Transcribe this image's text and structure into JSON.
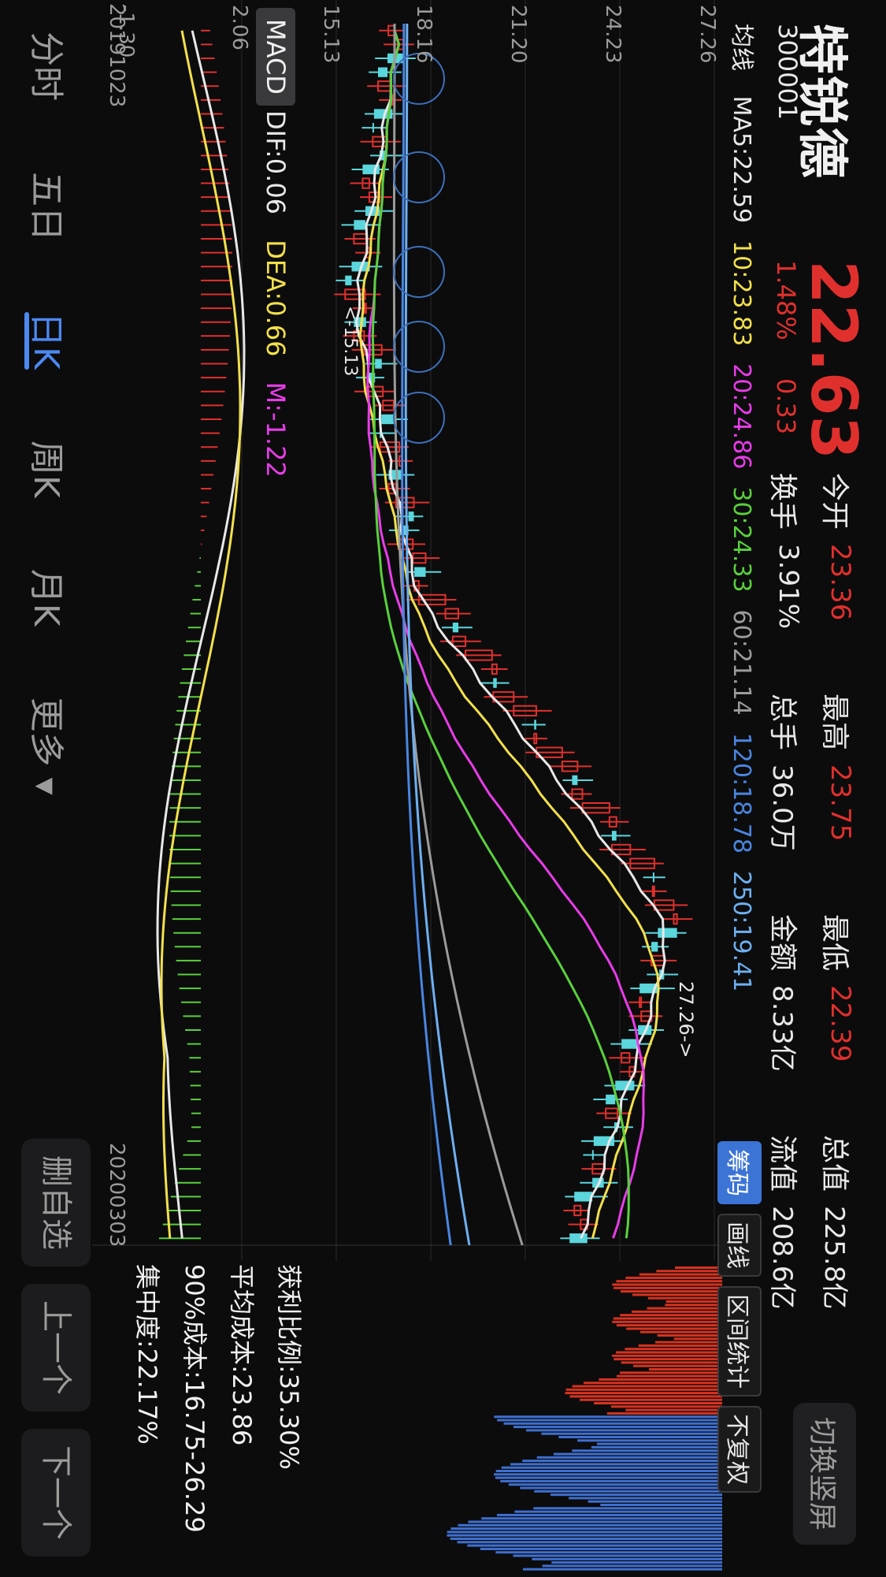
{
  "header": {
    "name": "特锐德",
    "code": "300001",
    "price": "22.63",
    "change_pct": "1.48%",
    "change_abs": "0.33",
    "stats": [
      {
        "label": "今开",
        "value": "23.36",
        "color": "red"
      },
      {
        "label": "最高",
        "value": "23.75",
        "color": "red"
      },
      {
        "label": "最低",
        "value": "22.39",
        "color": "red"
      },
      {
        "label": "总值",
        "value": "225.8亿",
        "color": "white"
      },
      {
        "label": "换手",
        "value": "3.91%",
        "color": "white"
      },
      {
        "label": "总手",
        "value": "36.0万",
        "color": "white"
      },
      {
        "label": "金额",
        "value": "8.33亿",
        "color": "white"
      },
      {
        "label": "流值",
        "value": "208.6亿",
        "color": "white"
      }
    ],
    "switch_button": "切换竖屏"
  },
  "ma": {
    "label": "均线",
    "items": [
      {
        "text": "MA5:22.59",
        "color": "#e8e8e8"
      },
      {
        "text": "10:23.83",
        "color": "#f2e04a"
      },
      {
        "text": "20:24.86",
        "color": "#e83ce8"
      },
      {
        "text": "30:24.33",
        "color": "#5ad03c"
      },
      {
        "text": "60:21.14",
        "color": "#9b9b9b"
      },
      {
        "text": "120:18.78",
        "color": "#4a86e0"
      },
      {
        "text": "250:19.41",
        "color": "#6fb0f0"
      }
    ]
  },
  "tools": {
    "chips": "筹码",
    "draw": "画线",
    "range": "区间统计",
    "adjust": "不复权"
  },
  "price_axis": [
    "27.26",
    "24.23",
    "21.20",
    "18.16",
    "15.13"
  ],
  "annotations": {
    "high": "27.26->",
    "low": "<-15.13"
  },
  "macd": {
    "tag": "MACD",
    "dif": "DIF:0.06",
    "dea": "DEA:0.66",
    "m": "M:-1.22",
    "axis": [
      "2.06",
      "-1.30"
    ]
  },
  "dates": {
    "start": "20191023",
    "end": "20200303"
  },
  "chip_info": {
    "profit": "获利比例:35.30%",
    "avg": "平均成本:23.86",
    "cost90": "90%成本:16.75-26.29",
    "concentration": "集中度:22.17%"
  },
  "periods": [
    "分时",
    "五日",
    "日K",
    "周K",
    "月K",
    "更多"
  ],
  "active_period": "日K",
  "bottom_buttons": [
    "删自选",
    "上一个",
    "下一个"
  ],
  "colors": {
    "up": "#e0302d",
    "down": "#5ad6dc",
    "accent": "#4d89f0",
    "chip_profit": "#d6331f",
    "chip_loss": "#3f6fd0"
  }
}
